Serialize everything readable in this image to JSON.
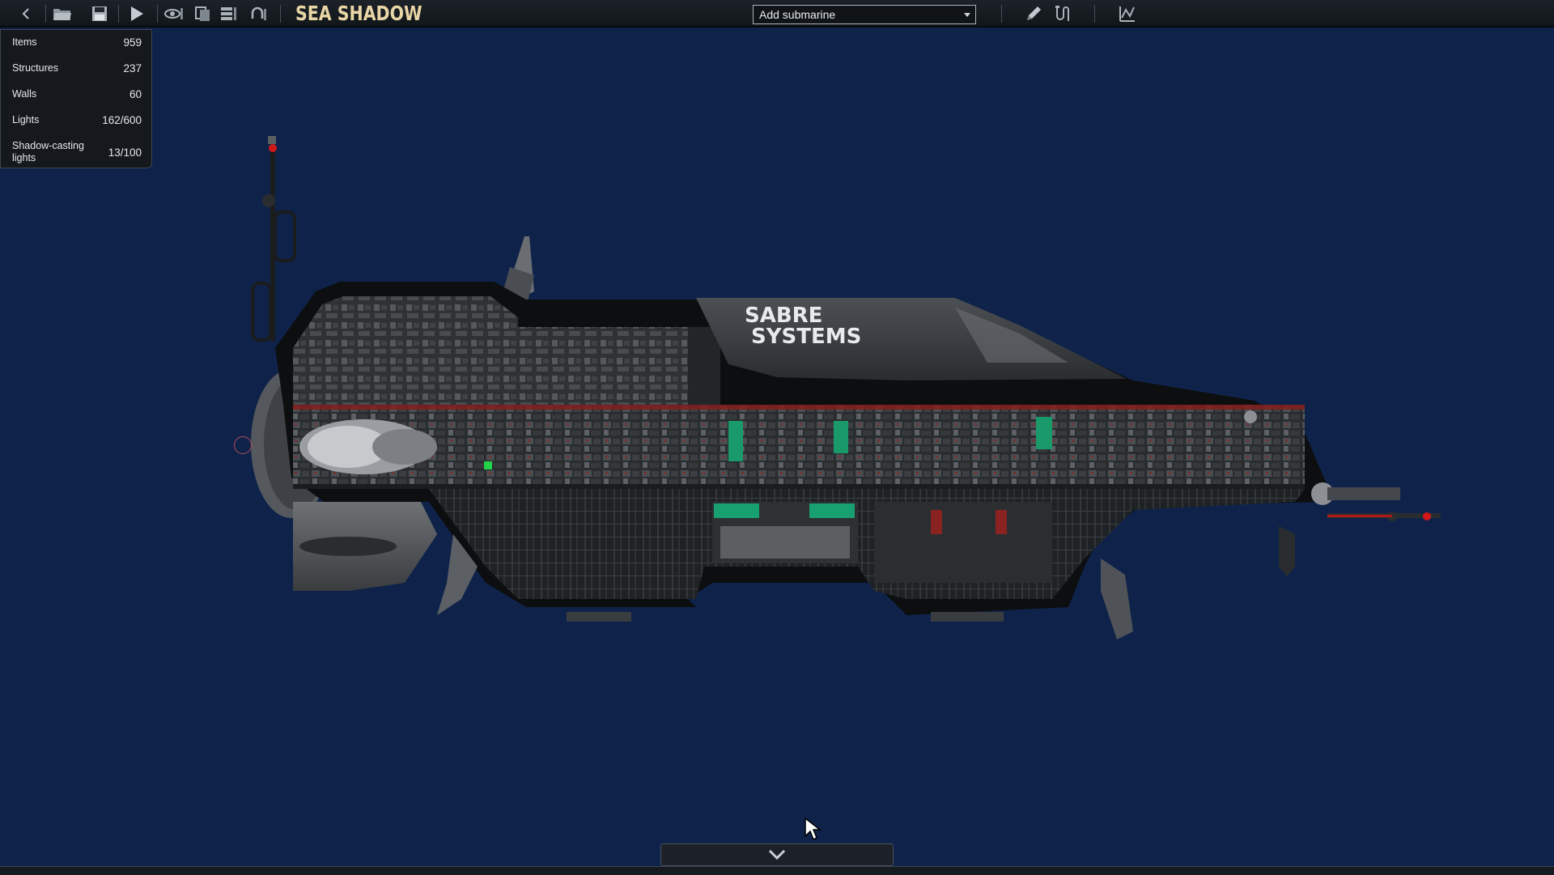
{
  "toolbar": {
    "buttons": [
      {
        "name": "back",
        "icon": "chevron-left-icon"
      },
      {
        "name": "open",
        "icon": "folder-open-icon"
      },
      {
        "name": "save",
        "icon": "save-icon"
      },
      {
        "name": "test",
        "icon": "play-icon"
      },
      {
        "name": "visibility",
        "icon": "eye-icon"
      },
      {
        "name": "hull-layer",
        "icon": "layers-icon"
      },
      {
        "name": "entity-list",
        "icon": "list-icon"
      },
      {
        "name": "undo-rotate",
        "icon": "rotate-icon"
      }
    ],
    "submarine_name": "SEA SHADOW",
    "add_submarine": {
      "label": "Add submarine"
    },
    "tools": [
      {
        "name": "pencil",
        "icon": "pencil-icon"
      },
      {
        "name": "wiring",
        "icon": "wire-icon"
      },
      {
        "name": "waypoints",
        "icon": "waypoint-icon"
      }
    ]
  },
  "stats": {
    "items": {
      "label": "Items",
      "value": "959"
    },
    "structures": {
      "label": "Structures",
      "value": "237"
    },
    "walls": {
      "label": "Walls",
      "value": "60"
    },
    "lights": {
      "label": "Lights",
      "value": "162/600"
    },
    "shadow_lights": {
      "label": "Shadow-casting lights",
      "value": "13/100"
    }
  },
  "hull_decal": {
    "line1": "SABRE",
    "line2": "SYSTEMS"
  },
  "bottom": {
    "toggle_icon": "chevron-down-icon"
  },
  "colors": {
    "background": "#0f234a",
    "title": "#e9d6a6",
    "panel": "#15191d"
  }
}
